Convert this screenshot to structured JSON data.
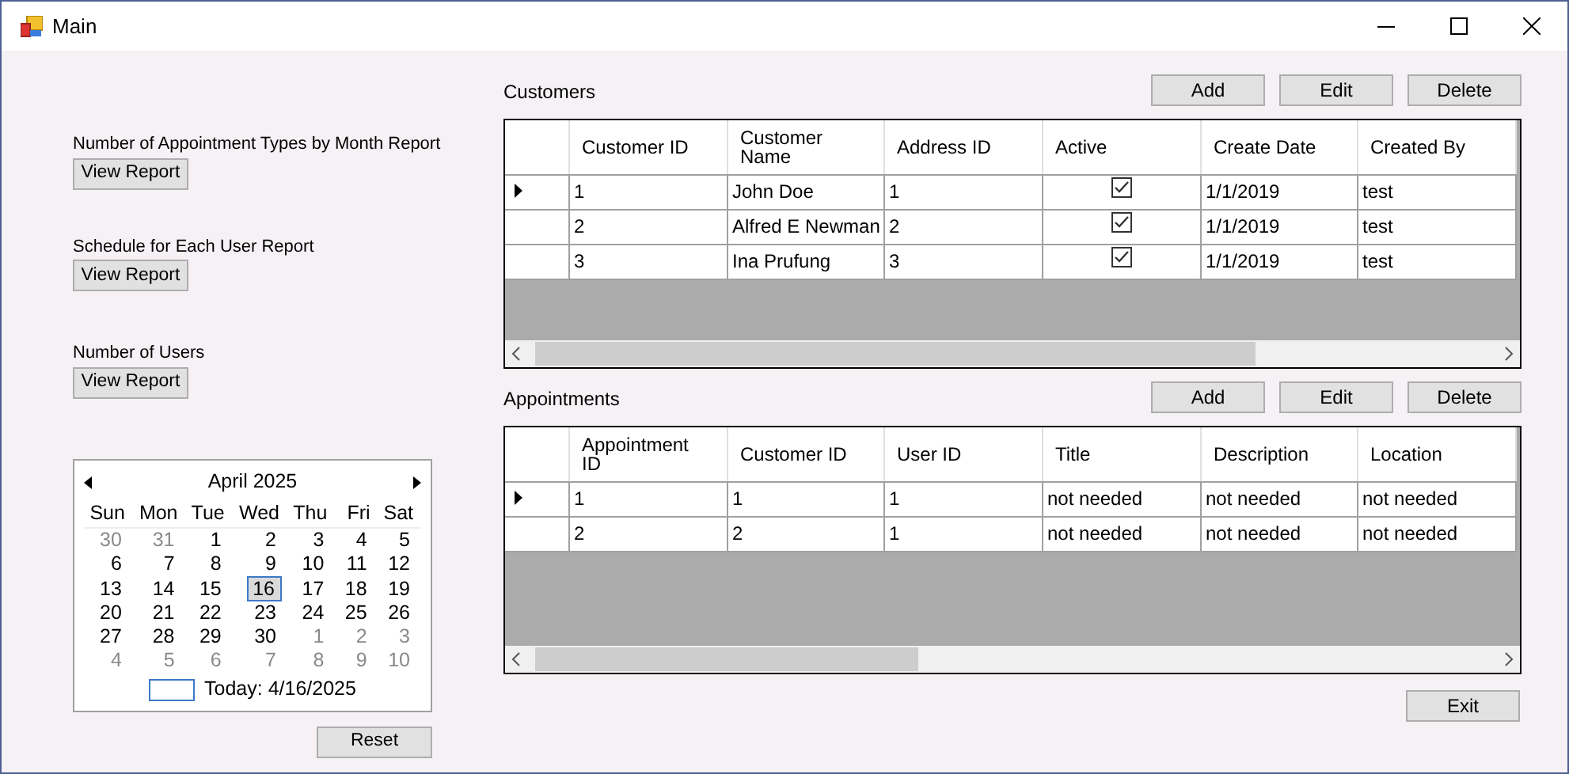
{
  "window": {
    "title": "Main"
  },
  "reports": [
    {
      "label": "Number of Appointment Types by Month Report",
      "button": "View Report"
    },
    {
      "label": "Schedule for Each User Report",
      "button": "View Report"
    },
    {
      "label": "Number of Users",
      "button": "View Report"
    }
  ],
  "calendar": {
    "month": "April 2025",
    "weekdays": [
      "Sun",
      "Mon",
      "Tue",
      "Wed",
      "Thu",
      "Fri",
      "Sat"
    ],
    "weeks": [
      [
        {
          "day": "30",
          "other_month": true,
          "selected": false
        },
        {
          "day": "31",
          "other_month": true,
          "selected": false
        },
        {
          "day": "1",
          "other_month": false,
          "selected": false
        },
        {
          "day": "2",
          "other_month": false,
          "selected": false
        },
        {
          "day": "3",
          "other_month": false,
          "selected": false
        },
        {
          "day": "4",
          "other_month": false,
          "selected": false
        },
        {
          "day": "5",
          "other_month": false,
          "selected": false
        }
      ],
      [
        {
          "day": "6",
          "other_month": false,
          "selected": false
        },
        {
          "day": "7",
          "other_month": false,
          "selected": false
        },
        {
          "day": "8",
          "other_month": false,
          "selected": false
        },
        {
          "day": "9",
          "other_month": false,
          "selected": false
        },
        {
          "day": "10",
          "other_month": false,
          "selected": false
        },
        {
          "day": "11",
          "other_month": false,
          "selected": false
        },
        {
          "day": "12",
          "other_month": false,
          "selected": false
        }
      ],
      [
        {
          "day": "13",
          "other_month": false,
          "selected": false
        },
        {
          "day": "14",
          "other_month": false,
          "selected": false
        },
        {
          "day": "15",
          "other_month": false,
          "selected": false
        },
        {
          "day": "16",
          "other_month": false,
          "selected": true
        },
        {
          "day": "17",
          "other_month": false,
          "selected": false
        },
        {
          "day": "18",
          "other_month": false,
          "selected": false
        },
        {
          "day": "19",
          "other_month": false,
          "selected": false
        }
      ],
      [
        {
          "day": "20",
          "other_month": false,
          "selected": false
        },
        {
          "day": "21",
          "other_month": false,
          "selected": false
        },
        {
          "day": "22",
          "other_month": false,
          "selected": false
        },
        {
          "day": "23",
          "other_month": false,
          "selected": false
        },
        {
          "day": "24",
          "other_month": false,
          "selected": false
        },
        {
          "day": "25",
          "other_month": false,
          "selected": false
        },
        {
          "day": "26",
          "other_month": false,
          "selected": false
        }
      ],
      [
        {
          "day": "27",
          "other_month": false,
          "selected": false
        },
        {
          "day": "28",
          "other_month": false,
          "selected": false
        },
        {
          "day": "29",
          "other_month": false,
          "selected": false
        },
        {
          "day": "30",
          "other_month": false,
          "selected": false
        },
        {
          "day": "1",
          "other_month": true,
          "selected": false
        },
        {
          "day": "2",
          "other_month": true,
          "selected": false
        },
        {
          "day": "3",
          "other_month": true,
          "selected": false
        }
      ],
      [
        {
          "day": "4",
          "other_month": true,
          "selected": false
        },
        {
          "day": "5",
          "other_month": true,
          "selected": false
        },
        {
          "day": "6",
          "other_month": true,
          "selected": false
        },
        {
          "day": "7",
          "other_month": true,
          "selected": false
        },
        {
          "day": "8",
          "other_month": true,
          "selected": false
        },
        {
          "day": "9",
          "other_month": true,
          "selected": false
        },
        {
          "day": "10",
          "other_month": true,
          "selected": false
        }
      ]
    ],
    "today": "Today: 4/16/2025"
  },
  "reset_button": "Reset",
  "grids": [
    {
      "title": "Customers",
      "buttons": [
        "Add",
        "Edit",
        "Delete"
      ],
      "columns": [
        "Customer ID",
        "Customer Name",
        "Address ID",
        "Active",
        "Create Date",
        "Created By"
      ],
      "rows": [
        {
          "current": true,
          "cells": [
            {
              "kind": "text",
              "text": "1"
            },
            {
              "kind": "text",
              "text": "John Doe"
            },
            {
              "kind": "text",
              "text": "1"
            },
            {
              "kind": "check",
              "checked": true
            },
            {
              "kind": "text",
              "text": "1/1/2019"
            },
            {
              "kind": "text",
              "text": "test"
            }
          ]
        },
        {
          "current": false,
          "cells": [
            {
              "kind": "text",
              "text": "2"
            },
            {
              "kind": "text",
              "text": "Alfred E Newman"
            },
            {
              "kind": "text",
              "text": "2"
            },
            {
              "kind": "check",
              "checked": true
            },
            {
              "kind": "text",
              "text": "1/1/2019"
            },
            {
              "kind": "text",
              "text": "test"
            }
          ]
        },
        {
          "current": false,
          "cells": [
            {
              "kind": "text",
              "text": "3"
            },
            {
              "kind": "text",
              "text": "Ina Prufung"
            },
            {
              "kind": "text",
              "text": "3"
            },
            {
              "kind": "check",
              "checked": true
            },
            {
              "kind": "text",
              "text": "1/1/2019"
            },
            {
              "kind": "text",
              "text": "test"
            }
          ]
        }
      ]
    },
    {
      "title": "Appointments",
      "buttons": [
        "Add",
        "Edit",
        "Delete"
      ],
      "columns": [
        "Appointment ID",
        "Customer ID",
        "User ID",
        "Title",
        "Description",
        "Location"
      ],
      "rows": [
        {
          "current": true,
          "cells": [
            {
              "kind": "text",
              "text": "1"
            },
            {
              "kind": "text",
              "text": "1"
            },
            {
              "kind": "text",
              "text": "1"
            },
            {
              "kind": "text",
              "text": "not needed"
            },
            {
              "kind": "text",
              "text": "not needed"
            },
            {
              "kind": "text",
              "text": "not needed"
            }
          ]
        },
        {
          "current": false,
          "cells": [
            {
              "kind": "text",
              "text": "2"
            },
            {
              "kind": "text",
              "text": "2"
            },
            {
              "kind": "text",
              "text": "1"
            },
            {
              "kind": "text",
              "text": "not needed"
            },
            {
              "kind": "text",
              "text": "not needed"
            },
            {
              "kind": "text",
              "text": "not needed"
            }
          ]
        }
      ]
    }
  ],
  "exit_button": "Exit"
}
